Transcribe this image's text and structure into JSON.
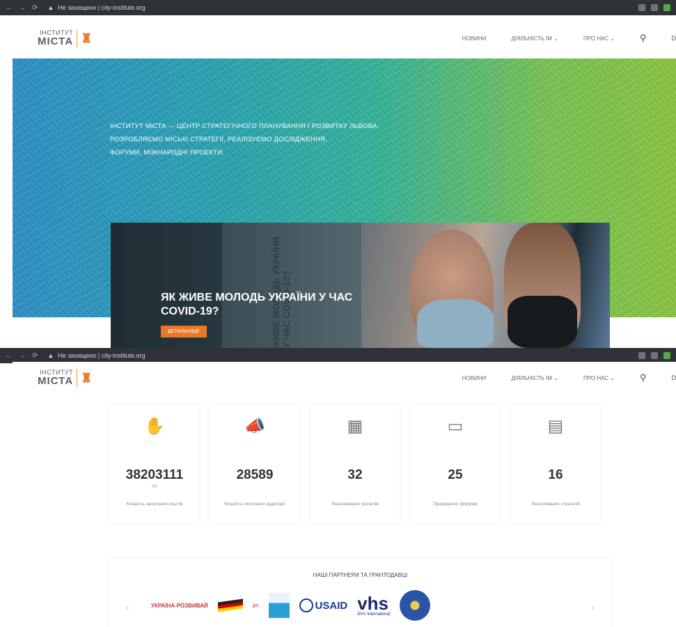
{
  "browser": {
    "url": "Не захищено | city-institute.org"
  },
  "header": {
    "logo_line1": "ІНСТИТУТ",
    "logo_line2": "МІСТА",
    "nav": [
      {
        "label": "НОВИНИ"
      },
      {
        "label": "ДІЯЛЬНІСТЬ ІМ ⌄"
      },
      {
        "label": "ПРО НАС ⌄"
      }
    ],
    "extra": "D"
  },
  "hero": {
    "line1": "ІНСТИТУТ МІСТА — ЦЕНТР СТРАТЕГІЧНОГО ПЛАНУВАННЯ І РОЗВИТКУ ЛЬВОВА.",
    "line2": "РОЗРОБЛЯЄМО МІСЬКІ СТРАТЕГІЇ, РЕАЛІЗУЄМО ДОСЛІДЖЕННЯ,",
    "line3": "ФОРУМИ, МІЖНАРОДНІ ПРОЕКТИ."
  },
  "feature": {
    "title": "ЯК ЖИВЕ МОЛОДЬ УКРАЇНИ У ЧАС COVID-19?",
    "button": "ДЕТАЛЬНІШЕ",
    "vertical_text": "ЖИВЕ МОЛОДЬ УКРАЇНИ У ЧАС COVID-19?"
  },
  "stats": [
    {
      "icon": "hand-coin-icon",
      "value": "38203111",
      "unit": "грн",
      "label": "Кількість залучених коштів"
    },
    {
      "icon": "megaphone-icon",
      "value": "28589",
      "unit": "",
      "label": "Кількість охопленої аудиторії"
    },
    {
      "icon": "board-icon",
      "value": "32",
      "unit": "",
      "label": "Реалізованих проектів"
    },
    {
      "icon": "presentation-icon",
      "value": "25",
      "unit": "",
      "label": "Проведених форумів"
    },
    {
      "icon": "map-icon",
      "value": "16",
      "unit": "",
      "label": "Реалізованих стратегій"
    }
  ],
  "partners": {
    "title": "НАШІ ПАРТНЕРИ ТА ГРАНТОДАВЦІ",
    "logos": [
      "УКРАЇНА-РОЗВИВАЙ",
      "giz",
      "USAID",
      "vhs",
      "DVV International"
    ]
  }
}
